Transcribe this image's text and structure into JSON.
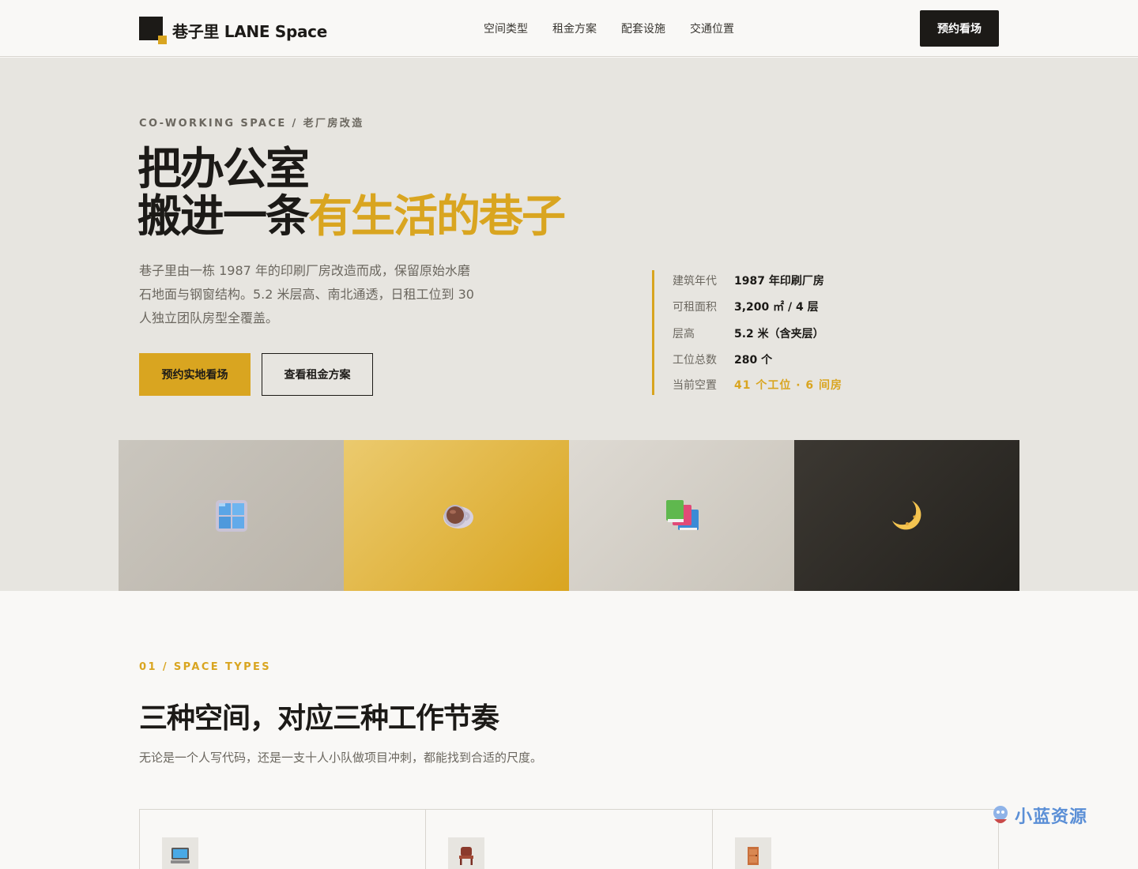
{
  "header": {
    "logo_text": "巷子里 LANE Space",
    "nav": [
      "空间类型",
      "租金方案",
      "配套设施",
      "交通位置"
    ],
    "cta_label": "预约看场"
  },
  "hero": {
    "eyebrow": "CO-WORKING SPACE / 老厂房改造",
    "title_line1": "把办公室",
    "title_line2_plain": "搬进一条",
    "title_line2_accent": "有生活的巷子",
    "description": "巷子里由一栋 1987 年的印刷厂房改造而成，保留原始水磨石地面与钢窗结构。5.2 米层高、南北通透，日租工位到 30 人独立团队房型全覆盖。",
    "primary_button": "预约实地看场",
    "secondary_button": "查看租金方案",
    "facts": [
      {
        "label": "建筑年代",
        "value": "1987 年印刷厂房"
      },
      {
        "label": "可租面积",
        "value": "3,200 ㎡ / 4 层"
      },
      {
        "label": "层高",
        "value": "5.2 米（含夹层）"
      },
      {
        "label": "工位总数",
        "value": "280 个"
      },
      {
        "label": "当前空置",
        "value": "41 个工位 · 6 间房"
      }
    ],
    "tiles": [
      "window-icon",
      "coffee-icon",
      "books-icon",
      "moon-icon"
    ]
  },
  "space_types": {
    "eyebrow": "01 / SPACE TYPES",
    "title": "三种空间，对应三种工作节奏",
    "description": "无论是一个人写代码，还是一支十人小队做项目冲刺，都能找到合适的尺度。",
    "cards": [
      "computer-icon",
      "chair-icon",
      "door-icon"
    ]
  },
  "watermark": {
    "text": "小蓝资源"
  },
  "colors": {
    "accent": "#d9a520",
    "dark": "#1c1a17",
    "hero_bg": "#e7e5e0",
    "page_bg": "#f9f8f6"
  }
}
